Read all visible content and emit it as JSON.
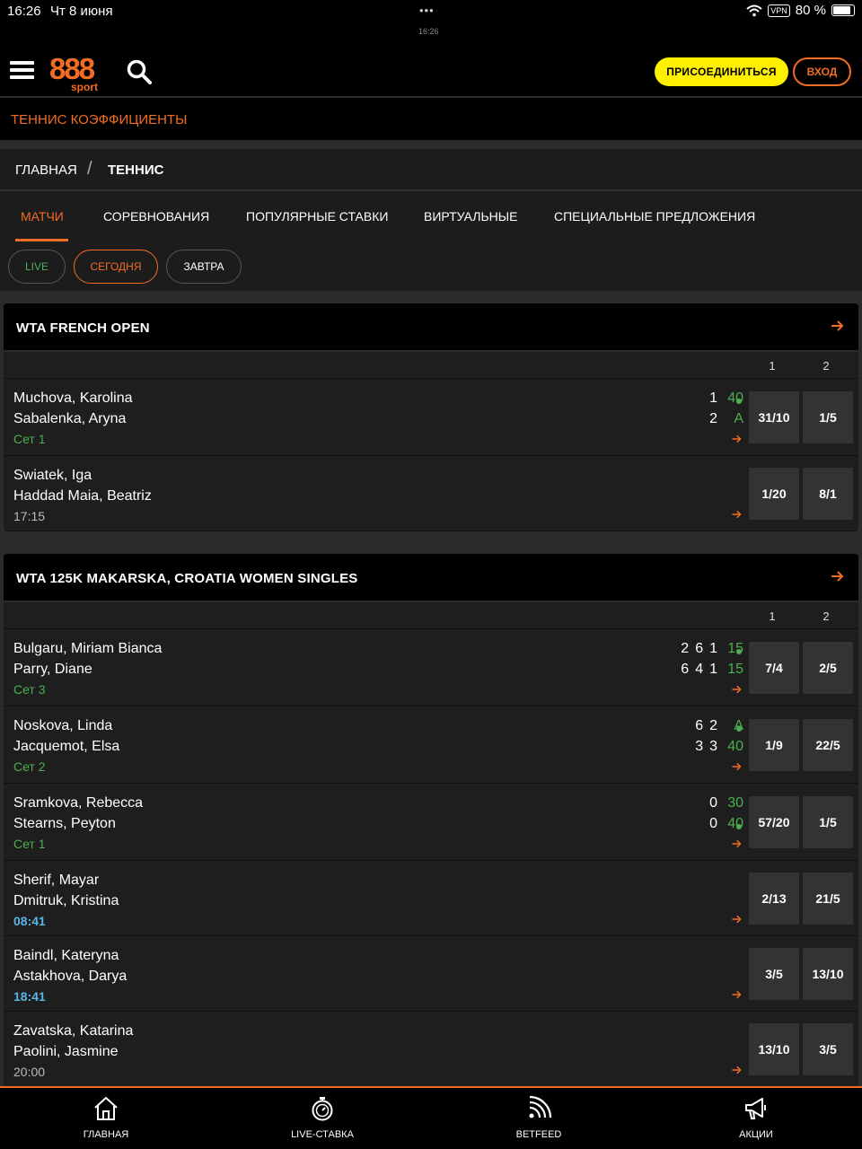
{
  "status_bar": {
    "time": "16:26",
    "date": "Чт 8 июня",
    "dots": "•••",
    "small_time": "16:26",
    "vpn": "VPN",
    "battery": "80 %"
  },
  "header": {
    "logo_number": "888",
    "logo_sub": "sport",
    "join_label": "ПРИСОЕДИНИТЬСЯ",
    "login_label": "ВХОД"
  },
  "subtitle": "ТЕННИС КОЭФФИЦИЕНТЫ",
  "breadcrumb": {
    "home": "ГЛАВНАЯ",
    "separator": "/",
    "current": "ТЕННИС"
  },
  "tabs": [
    "МАТЧИ",
    "СОРЕВНОВАНИЯ",
    "ПОПУЛЯРНЫЕ СТАВКИ",
    "ВИРТУАЛЬНЫЕ",
    "СПЕЦИАЛЬНЫЕ ПРЕДЛОЖЕНИЯ"
  ],
  "filters": {
    "live": "LIVE",
    "today": "СЕГОДНЯ",
    "tomorrow": "ЗАВТРА"
  },
  "accent_colors": {
    "brand": "#f26c23",
    "live": "#4caf50",
    "join": "#fff000"
  },
  "column_headers": [
    "1",
    "2"
  ],
  "tournaments": [
    {
      "title": "WTA FRENCH OPEN",
      "matches": [
        {
          "p1": "Muchova, Karolina",
          "p2": "Sabalenka, Aryna",
          "status": "Сет 1",
          "s1": [
            "1"
          ],
          "s2": [
            "2"
          ],
          "pt1": "40",
          "pt2": "A",
          "odd1": "31/10",
          "odd2": "1/5"
        },
        {
          "p1": "Swiatek, Iga",
          "p2": "Haddad Maia, Beatriz",
          "status": "17:15",
          "odd1": "1/20",
          "odd2": "8/1"
        }
      ]
    },
    {
      "title": "WTA 125K MAKARSKA, CROATIA WOMEN SINGLES",
      "matches": [
        {
          "p1": "Bulgaru, Miriam Bianca",
          "p2": "Parry, Diane",
          "status": "Сет 3",
          "s1": [
            "2",
            "6",
            "1"
          ],
          "s2": [
            "6",
            "4",
            "1"
          ],
          "pt1": "15",
          "pt2": "15",
          "odd1": "7/4",
          "odd2": "2/5"
        },
        {
          "p1": "Noskova, Linda",
          "p2": "Jacquemot, Elsa",
          "status": "Сет 2",
          "s1": [
            "6",
            "2"
          ],
          "s2": [
            "3",
            "3"
          ],
          "pt1": "A",
          "pt2": "40",
          "odd1": "1/9",
          "odd2": "22/5"
        },
        {
          "p1": "Sramkova, Rebecca",
          "p2": "Stearns, Peyton",
          "status": "Сет 1",
          "s1": [
            "0"
          ],
          "s2": [
            "0"
          ],
          "pt1": "30",
          "pt2": "40",
          "odd1": "57/20",
          "odd2": "1/5"
        },
        {
          "p1": "Sherif, Mayar",
          "p2": "Dmitruk, Kristina",
          "status": "08:41",
          "odd1": "2/13",
          "odd2": "21/5"
        },
        {
          "p1": "Baindl, Kateryna",
          "p2": "Astakhova, Darya",
          "status": "18:41",
          "odd1": "3/5",
          "odd2": "13/10"
        },
        {
          "p1": "Zavatska, Katarina",
          "p2": "Paolini, Jasmine",
          "status": "20:00",
          "odd1": "13/10",
          "odd2": "3/5"
        }
      ]
    }
  ],
  "bottom_nav": [
    {
      "label": "ГЛАВНАЯ",
      "icon": "home-icon"
    },
    {
      "label": "LIVE-СТАВКА",
      "icon": "stopwatch-icon"
    },
    {
      "label": "BETFEED",
      "icon": "feed-icon"
    },
    {
      "label": "АКЦИИ",
      "icon": "megaphone-icon"
    }
  ]
}
